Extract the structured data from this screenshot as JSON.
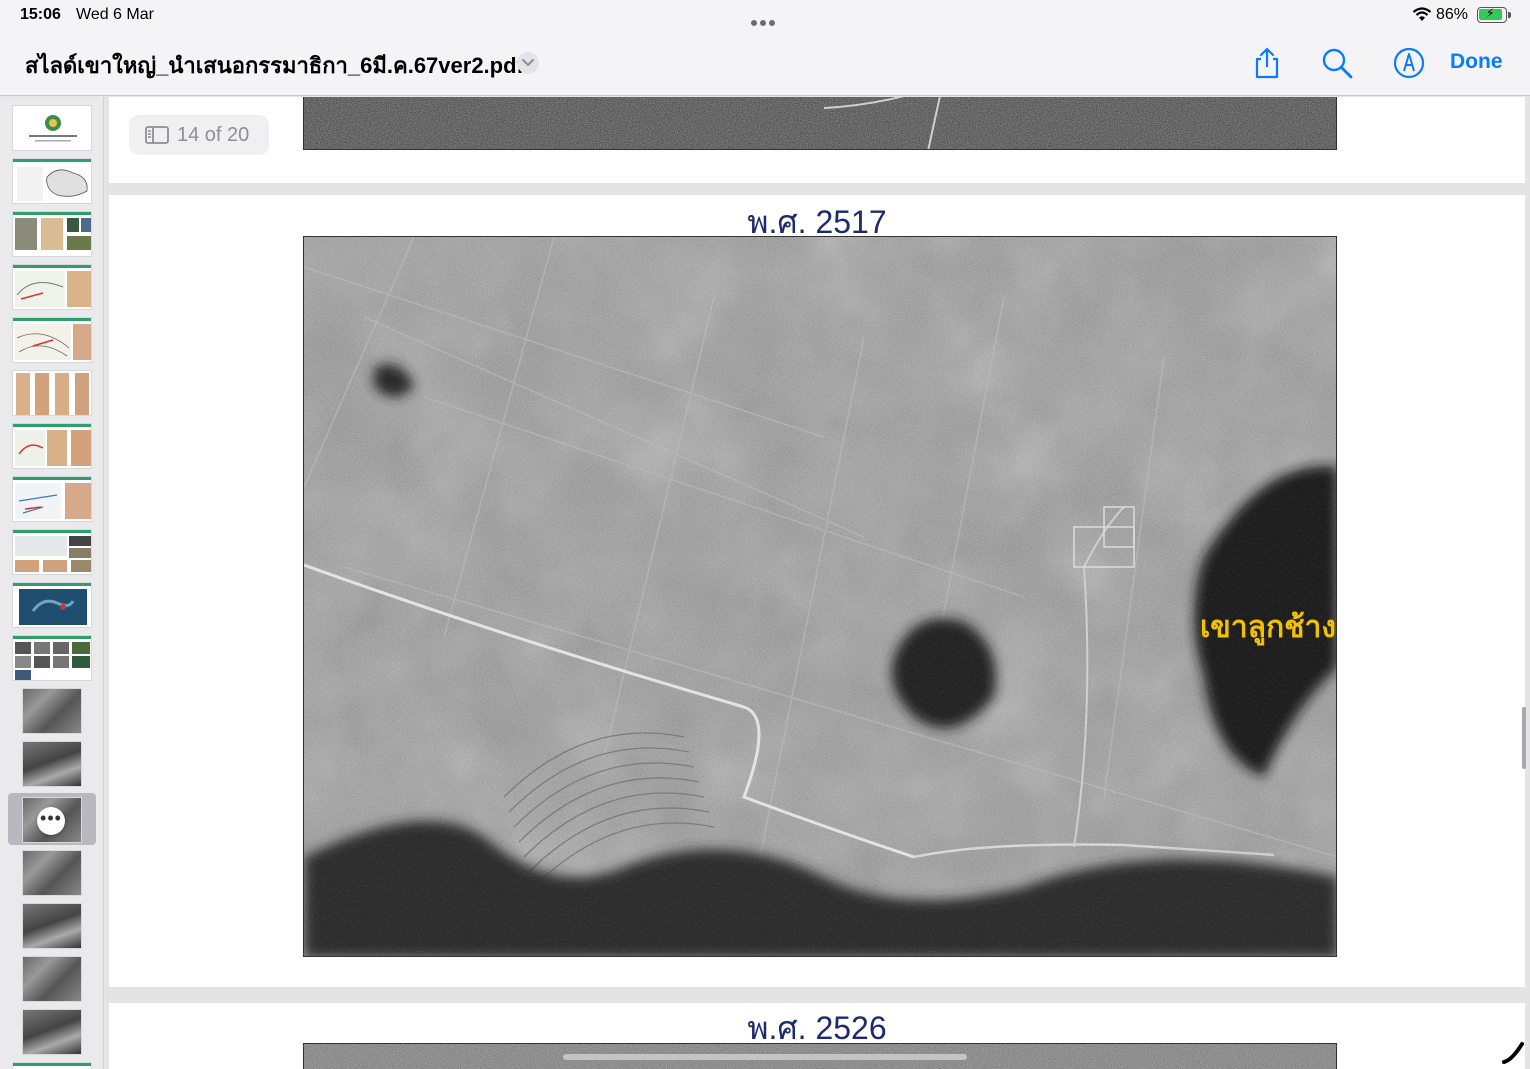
{
  "status_bar": {
    "time": "15:06",
    "date": "Wed 6 Mar",
    "battery_percent": "86%",
    "battery_level": 0.86
  },
  "nav_bar": {
    "document_title": "สไลด์เขาใหญ่_นำเสนอกรรมาธิกา_6มี.ค.67ver2.pdf",
    "share_icon": "share-icon",
    "search_icon": "search-icon",
    "markup_icon": "markup-icon",
    "done_label": "Done",
    "accent_color": "#0a7aff"
  },
  "page_indicator": {
    "text": "14 of 20",
    "icon": "sidebar-icon"
  },
  "pages": {
    "current": {
      "title": "พ.ศ. 2517",
      "map_label": "เขาลูกช้าง"
    },
    "next": {
      "title": "พ.ศ. 2526"
    }
  },
  "sidebar": {
    "selected_index": 13,
    "more_icon": "more-icon"
  }
}
